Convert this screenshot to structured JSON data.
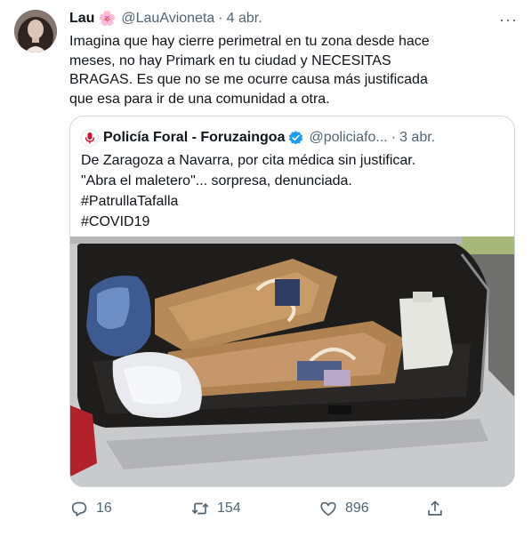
{
  "tweet": {
    "author_name": "Lau",
    "author_emoji": "🌸",
    "author_handle": "@LauAvioneta",
    "separator": "·",
    "date": "4 abr.",
    "more_label": "···",
    "text": "Imagina que hay cierre perimetral en tu zona desde hace\nmeses, no hay Primark en tu ciudad y NECESITAS\nBRAGAS. Es que no se me ocurre causa más justificada\nque esa para ir de una comunidad a otra."
  },
  "quote": {
    "author_name": "Policía Foral - Foruzaingoa",
    "author_handle": "@policiafo...",
    "separator": "·",
    "date": "3 abr.",
    "text": "De Zaragoza a Navarra, por cita médica sin justificar.\n\"Abra el maletero\"... sorpresa, denunciada.\n#PatrullaTafalla\n#COVID19",
    "verified_color": "#1d9bf0",
    "avatar_color": "#d0102c"
  },
  "actions": {
    "reply_count": "16",
    "retweet_count": "154",
    "like_count": "896"
  }
}
